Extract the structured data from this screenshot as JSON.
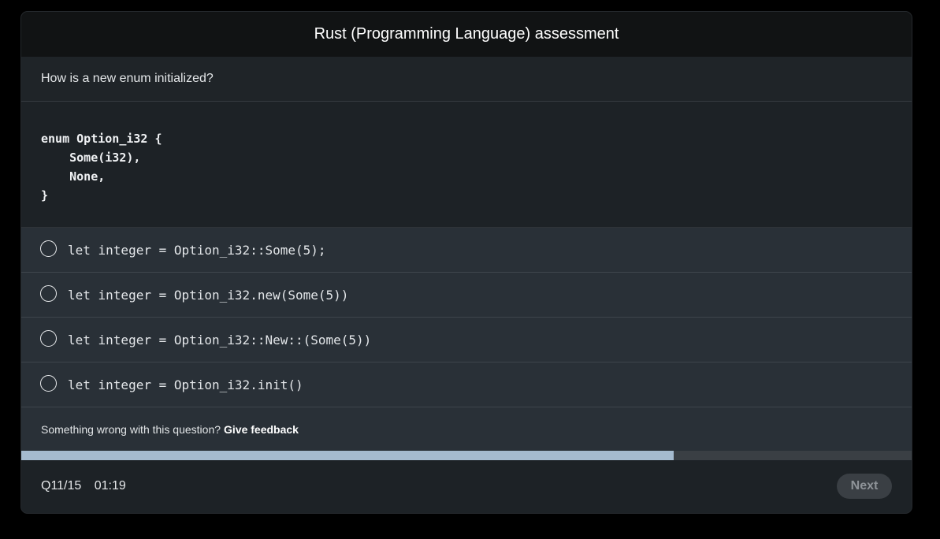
{
  "header": {
    "title": "Rust (Programming Language) assessment"
  },
  "question": {
    "text": "How is a new enum initialized?",
    "code": "enum Option_i32 {\n    Some(i32),\n    None,\n}"
  },
  "options": [
    {
      "label": "let integer = Option_i32::Some(5);"
    },
    {
      "label": "let integer = Option_i32.new(Some(5))"
    },
    {
      "label": "let integer = Option_i32::New::(Some(5))"
    },
    {
      "label": "let integer = Option_i32.init()"
    }
  ],
  "feedback": {
    "prompt": "Something wrong with this question?",
    "link_label": "Give feedback"
  },
  "progress": {
    "fraction": 0.733
  },
  "footer": {
    "question_counter": "Q11/15",
    "timer": "01:19",
    "next_label": "Next"
  },
  "colors": {
    "progress_fill": "#a5bbcf",
    "background": "#1d2226",
    "option_background": "#293037"
  }
}
